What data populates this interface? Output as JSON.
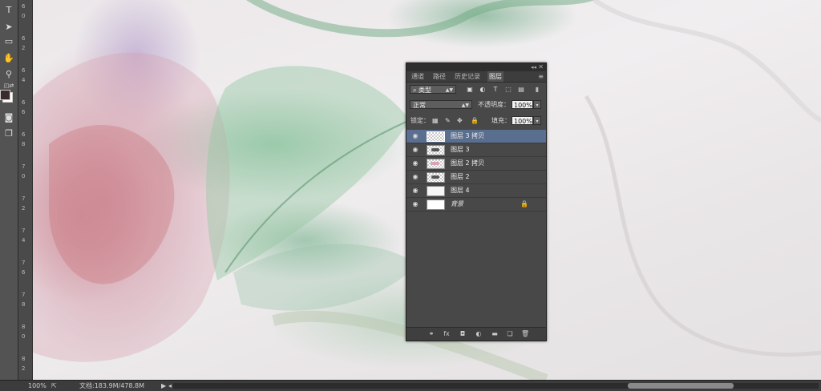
{
  "app": {
    "tools": [
      "type-tool",
      "path-select-tool",
      "rectangle-tool",
      "hand-tool",
      "zoom-tool"
    ],
    "colors": {
      "foreground": "#3b2a2a",
      "background": "#ffffff"
    }
  },
  "ruler": {
    "ticks": [
      "6",
      "0",
      "6",
      "2",
      "6",
      "4",
      "6",
      "6",
      "6",
      "8",
      "7",
      "0",
      "7",
      "2",
      "7",
      "4",
      "7",
      "6",
      "7",
      "8",
      "8",
      "0",
      "8",
      "2"
    ]
  },
  "panel": {
    "tabs": [
      "通道",
      "路径",
      "历史记录",
      "图层"
    ],
    "active_tab": "图层",
    "filter": {
      "kind_label": "类型"
    },
    "blend_mode": "正常",
    "opacity_label": "不透明度：",
    "opacity_value": "100%",
    "lock_label": "锁定：",
    "fill_label": "填充：",
    "fill_value": "100%",
    "layers": [
      {
        "name": "图层 3 拷贝",
        "selected": true,
        "visible": true
      },
      {
        "name": "图层 3",
        "selected": false,
        "visible": true
      },
      {
        "name": "图层 2 拷贝",
        "selected": false,
        "visible": true
      },
      {
        "name": "图层 2",
        "selected": false,
        "visible": true
      },
      {
        "name": "图层 4",
        "selected": false,
        "visible": true
      },
      {
        "name": "背景",
        "selected": false,
        "visible": true,
        "locked": true
      }
    ],
    "footer_icons": [
      "link-icon",
      "fx-icon",
      "mask-icon",
      "adjustment-icon",
      "folder-icon",
      "new-layer-icon",
      "trash-icon"
    ]
  },
  "status": {
    "zoom": "100%",
    "doc_info": "文档:183.9M/478.8M"
  }
}
